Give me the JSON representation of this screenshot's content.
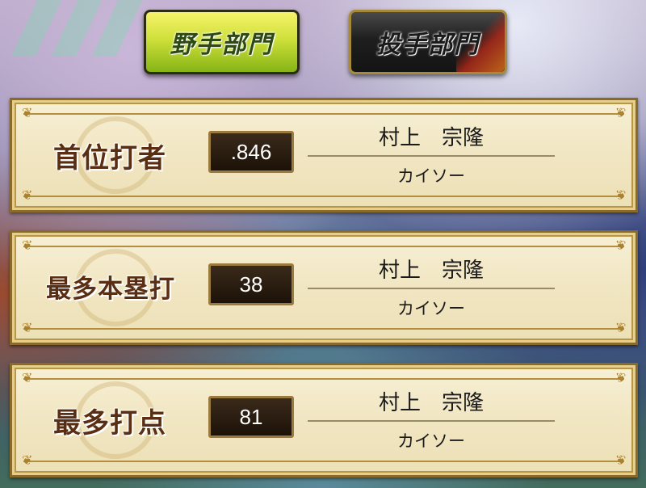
{
  "tabs": {
    "fielder": "野手部門",
    "pitcher": "投手部門"
  },
  "awards": [
    {
      "title": "首位打者",
      "value": ".846",
      "player": "村上　宗隆",
      "team": "カイソー"
    },
    {
      "title": "最多本塁打",
      "value": "38",
      "player": "村上　宗隆",
      "team": "カイソー"
    },
    {
      "title": "最多打点",
      "value": "81",
      "player": "村上　宗隆",
      "team": "カイソー"
    }
  ],
  "colors": {
    "fielder_tab": "#cfe03a",
    "pitcher_tab": "#1e1e1e",
    "card_bg": "#f1e6c2",
    "value_box": "#2a1c10",
    "title_text": "#5a2e12"
  }
}
